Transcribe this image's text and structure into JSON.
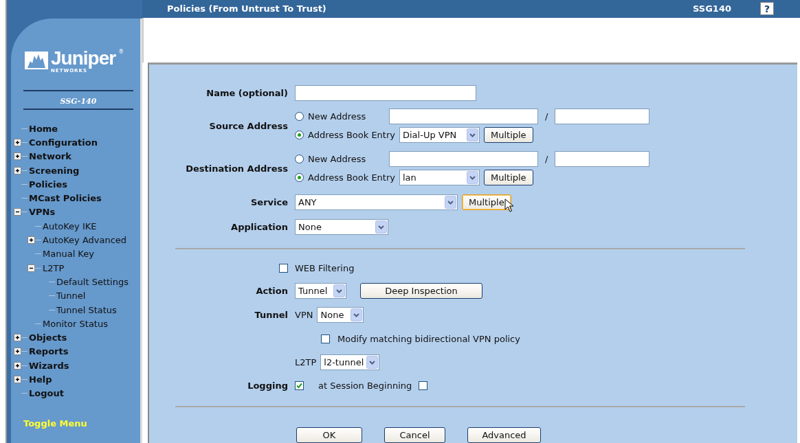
{
  "header": {
    "title": "Policies (From Untrust To Trust)",
    "device": "SSG140",
    "help": "?"
  },
  "logo": {
    "name": "Juniper",
    "sub": "NETWORKS",
    "mark": "®"
  },
  "device_label": "SSG-140",
  "nav": [
    {
      "label": "Home",
      "kind": "page"
    },
    {
      "label": "Configuration",
      "kind": "folder",
      "expanded": false
    },
    {
      "label": "Network",
      "kind": "folder",
      "expanded": false
    },
    {
      "label": "Screening",
      "kind": "folder",
      "expanded": false
    },
    {
      "label": "Policies",
      "kind": "page"
    },
    {
      "label": "MCast Policies",
      "kind": "page"
    },
    {
      "label": "VPNs",
      "kind": "folder",
      "expanded": true,
      "children": [
        {
          "label": "AutoKey IKE",
          "kind": "page"
        },
        {
          "label": "AutoKey Advanced",
          "kind": "folder",
          "expanded": false
        },
        {
          "label": "Manual Key",
          "kind": "page"
        },
        {
          "label": "L2TP",
          "kind": "folder",
          "expanded": true,
          "children": [
            {
              "label": "Default Settings",
              "kind": "page"
            },
            {
              "label": "Tunnel",
              "kind": "page"
            },
            {
              "label": "Tunnel Status",
              "kind": "page"
            }
          ]
        },
        {
          "label": "Monitor Status",
          "kind": "page"
        }
      ]
    },
    {
      "label": "Objects",
      "kind": "folder",
      "expanded": false
    },
    {
      "label": "Reports",
      "kind": "folder",
      "expanded": false
    },
    {
      "label": "Wizards",
      "kind": "folder",
      "expanded": false
    },
    {
      "label": "Help",
      "kind": "folder",
      "expanded": false
    },
    {
      "label": "Logout",
      "kind": "page"
    }
  ],
  "toggle_menu": "Toggle Menu",
  "form": {
    "name": {
      "label": "Name (optional)"
    },
    "source": {
      "label": "Source Address",
      "new_label": "New Address",
      "new_selected": false,
      "separator": "/",
      "book_label": "Address Book Entry",
      "book_selected": true,
      "book_value": "Dial-Up VPN",
      "button": "Multiple"
    },
    "destination": {
      "label": "Destination Address",
      "new_label": "New Address",
      "new_selected": false,
      "separator": "/",
      "book_label": "Address Book Entry",
      "book_selected": true,
      "book_value": "lan",
      "button": "Multiple"
    },
    "service": {
      "label": "Service",
      "value": "ANY",
      "button": "Multiple",
      "button_focused": true
    },
    "application": {
      "label": "Application",
      "value": "None"
    },
    "web_filtering": {
      "label": "WEB Filtering",
      "checked": false
    },
    "action": {
      "label": "Action",
      "value": "Tunnel",
      "button": "Deep Inspection"
    },
    "tunnel": {
      "label": "Tunnel",
      "vpn_label": "VPN",
      "vpn_value": "None",
      "modify_label": "Modify matching bidirectional VPN policy",
      "modify_checked": false,
      "l2tp_label": "L2TP",
      "l2tp_value": "l2-tunnel"
    },
    "logging": {
      "label": "Logging",
      "checked": true,
      "session_label": "at Session Beginning",
      "session_checked": false
    }
  },
  "buttons": [
    "OK",
    "Cancel",
    "Advanced"
  ]
}
